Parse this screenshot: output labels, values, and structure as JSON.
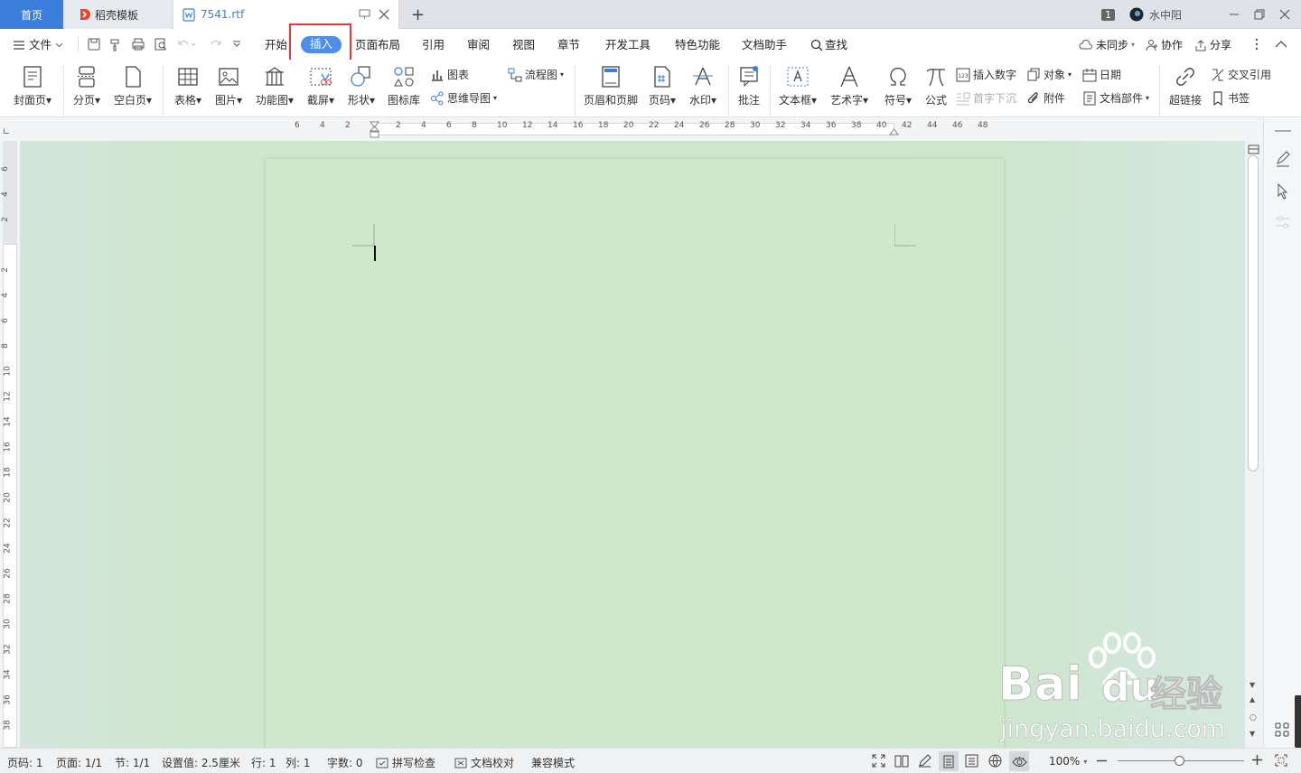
{
  "tabs": {
    "home": "首页",
    "daoke": "稻壳模板",
    "doc": "7541.rtf"
  },
  "account": {
    "badge": "1",
    "user": "水中阳"
  },
  "menu": {
    "file": "文件",
    "items": [
      "开始",
      "插入",
      "页面布局",
      "引用",
      "审阅",
      "视图",
      "章节",
      "开发工具",
      "特色功能",
      "文档助手"
    ],
    "active": "插入",
    "search": "查找",
    "sync": "未同步",
    "collab": "协作",
    "share": "分享"
  },
  "ribbon": {
    "cover": "封面页",
    "pagebreak": "分页",
    "blank": "空白页",
    "table": "表格",
    "picture": "图片",
    "funcmap": "功能图",
    "screenshot": "截屏",
    "shape": "形状",
    "iconlib": "图标库",
    "chart": "图表",
    "mindmap": "思维导图",
    "flowchart": "流程图",
    "headerfooter": "页眉和页脚",
    "pagenum": "页码",
    "watermark": "水印",
    "comment": "批注",
    "textbox": "文本框",
    "wordart": "艺术字",
    "symbol": "符号",
    "formula": "公式",
    "insertnum": "插入数字",
    "object": "对象",
    "date": "日期",
    "dropcap": "首字下沉",
    "attach": "附件",
    "docpart": "文档部件",
    "hyperlink": "超链接",
    "crossref": "交叉引用",
    "bookmark": "书签"
  },
  "ruler": {
    "h": [
      "6",
      "4",
      "2",
      "2",
      "4",
      "6",
      "8",
      "10",
      "12",
      "14",
      "16",
      "18",
      "20",
      "22",
      "24",
      "26",
      "28",
      "30",
      "32",
      "34",
      "36",
      "38",
      "40",
      "42",
      "44",
      "46",
      "48"
    ],
    "v": [
      "6",
      "4",
      "2",
      "2",
      "4",
      "6",
      "8",
      "10",
      "12",
      "14",
      "16",
      "18",
      "20",
      "22",
      "24",
      "26",
      "28",
      "30",
      "32",
      "34",
      "36",
      "38"
    ]
  },
  "status": {
    "page": "页码: 1",
    "pages": "页面: 1/1",
    "section": "节: 1/1",
    "setting": "设置值: 2.5厘米",
    "row": "行: 1",
    "col": "列: 1",
    "words": "字数: 0",
    "spell": "拼写检查",
    "proof": "文档校对",
    "compat": "兼容模式",
    "zoom": "100%"
  },
  "watermark": {
    "brand": "Bai",
    "brand2": "du",
    "cn": "经验",
    "url": "jingyan.baidu.com"
  }
}
